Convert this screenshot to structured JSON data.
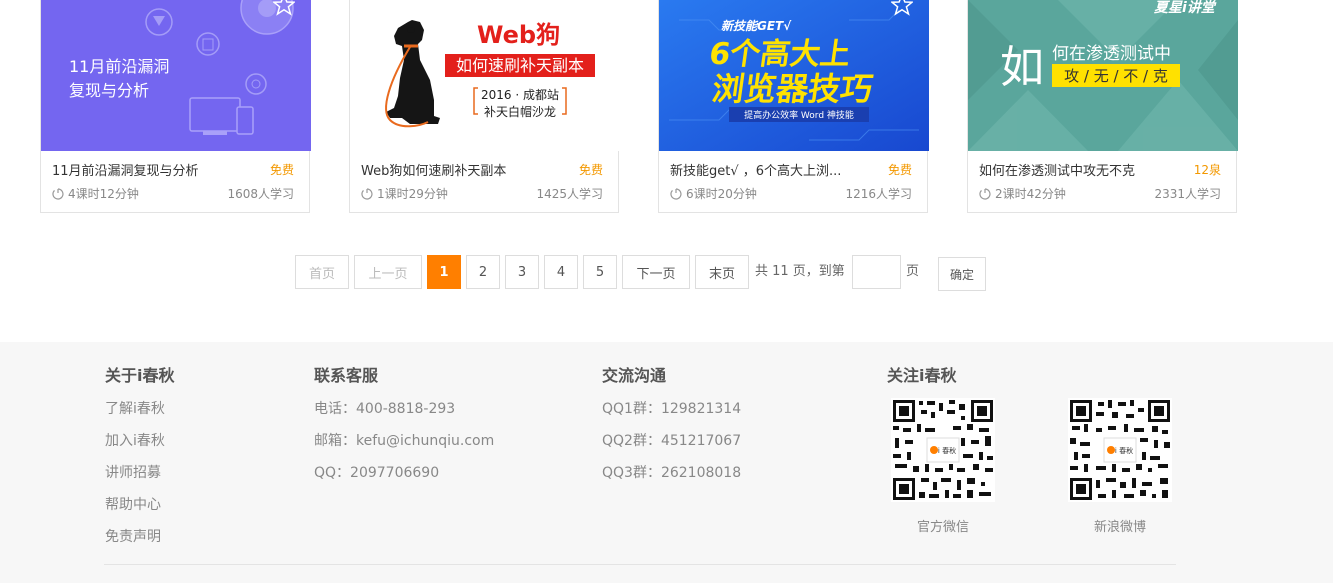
{
  "courses": [
    {
      "thumb_text": [
        "11月前沿漏洞",
        "复现与分析"
      ],
      "title": "11月前沿漏洞复现与分析",
      "price": "免费",
      "duration": "4课时12分钟",
      "learners": "1608人学习",
      "colors": {
        "bg": "#7466f0"
      }
    },
    {
      "thumb_text": [
        "Web狗",
        "如何速刷补天副本",
        "2016 · 成都站",
        "补天白帽沙龙"
      ],
      "title": "Web狗如何速刷补天副本",
      "price": "免费",
      "duration": "1课时29分钟",
      "learners": "1425人学习",
      "colors": {
        "bg": "#ffffff",
        "accent": "#e3201b"
      }
    },
    {
      "thumb_text": [
        "新技能GET√",
        "6个高大上",
        "浏览器技巧",
        "提高办公效率 Word 神技能"
      ],
      "title": "新技能get√ ，6个高大上浏...",
      "price": "免费",
      "duration": "6课时20分钟",
      "learners": "1216人学习",
      "colors": {
        "bg": "#1e5fe0",
        "accent": "#ffe200"
      }
    },
    {
      "thumb_text": [
        "如",
        "何在渗透测试中",
        "攻 / 无 / 不 / 克",
        "夏星i讲堂"
      ],
      "title": "如何在渗透测试中攻无不克",
      "price": "12泉",
      "duration": "2课时42分钟",
      "learners": "2331人学习",
      "colors": {
        "bg": "#5aa69c",
        "accent": "#ffe100"
      }
    }
  ],
  "pagination": {
    "first": "首页",
    "prev": "上一页",
    "pages": [
      "1",
      "2",
      "3",
      "4",
      "5"
    ],
    "current_page": "1",
    "next": "下一页",
    "last": "末页",
    "total_text": "共 11 页，到第",
    "page_suffix": "页",
    "input_value": "",
    "confirm": "确定"
  },
  "footer": {
    "about": {
      "title": "关于i春秋",
      "links": [
        "了解i春秋",
        "加入i春秋",
        "讲师招募",
        "帮助中心",
        "免责声明"
      ]
    },
    "service": {
      "title": "联系客服",
      "items": [
        "电话：400-8818-293",
        "邮箱：kefu@ichunqiu.com",
        "QQ：2097706690"
      ]
    },
    "community": {
      "title": "交流沟通",
      "items": [
        "QQ1群：129821314",
        "QQ2群：451217067",
        "QQ3群：262108018"
      ]
    },
    "follow": {
      "title": "关注i春秋",
      "qr_labels": [
        "官方微信",
        "新浪微博"
      ],
      "qr_logo_text": "i 春秋"
    }
  },
  "colors": {
    "accent_orange": "#ff7f00",
    "price_orange": "#f39800",
    "footer_bg": "#f7f7f7"
  }
}
